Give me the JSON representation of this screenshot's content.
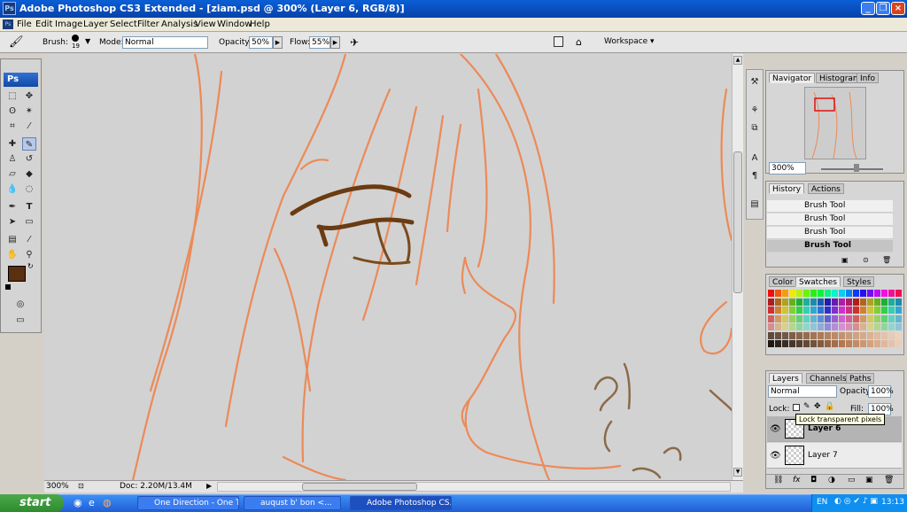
{
  "window": {
    "title": "Adobe Photoshop CS3 Extended - [ziam.psd @ 300% (Layer 6, RGB/8)]",
    "icon_text": "Ps"
  },
  "menu": [
    "File",
    "Edit",
    "Image",
    "Layer",
    "Select",
    "Filter",
    "Analysis",
    "View",
    "Window",
    "Help"
  ],
  "options": {
    "brush_label": "Brush:",
    "brush_size": "19",
    "mode_label": "Mode:",
    "mode_value": "Normal",
    "opacity_label": "Opacity:",
    "opacity_value": "50%",
    "flow_label": "Flow:",
    "flow_value": "55%",
    "workspace": "Workspace ▾"
  },
  "toolbox": {
    "badge": "Ps"
  },
  "status": {
    "zoom": "300%",
    "doc": "Doc: 2.20M/13.4M"
  },
  "navigator": {
    "tabs": [
      "Navigator",
      "Histogram",
      "Info"
    ],
    "zoom": "300%"
  },
  "history": {
    "tabs": [
      "History",
      "Actions"
    ],
    "items": [
      "Brush Tool",
      "Brush Tool",
      "Brush Tool",
      "Brush Tool"
    ]
  },
  "color": {
    "tabs": [
      "Color",
      "Swatches",
      "Styles"
    ]
  },
  "layers": {
    "tabs": [
      "Layers",
      "Channels",
      "Paths"
    ],
    "blend_mode": "Normal",
    "opacity_label": "Opacity:",
    "opacity_value": "100%",
    "lock_label": "Lock:",
    "fill_label": "Fill:",
    "fill_value": "100%",
    "tooltip": "Lock transparent pixels",
    "items": [
      {
        "name": "Layer 6"
      },
      {
        "name": "Layer 7"
      }
    ]
  },
  "taskbar": {
    "start": "start",
    "tasks": [
      "One Direction - One T...",
      "auqust b' bon <...",
      "Adobe Photoshop CS..."
    ],
    "lang": "EN",
    "clock": "13:13"
  },
  "colors": {
    "stroke": "#ec8a58",
    "brown": "#6b3b12",
    "foreground": "#5a3010",
    "xp_blue": "#215dd6"
  }
}
